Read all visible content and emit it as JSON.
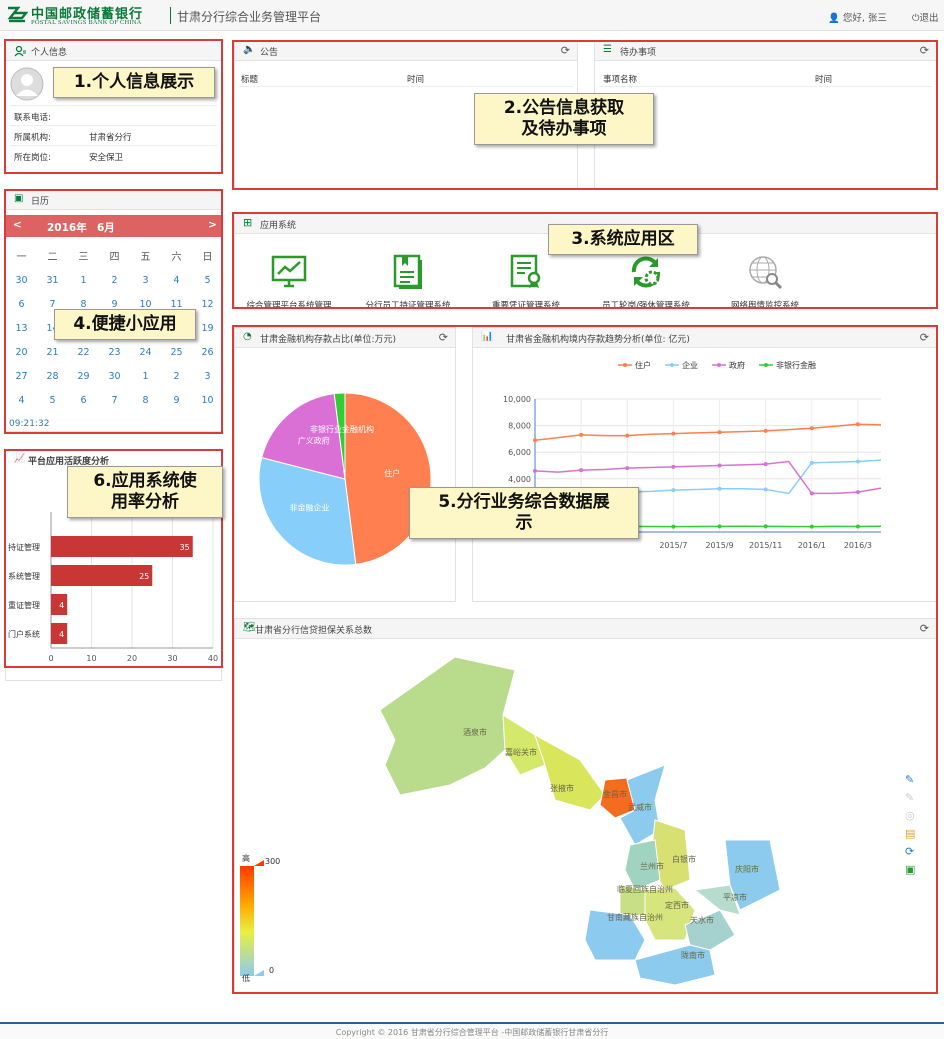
{
  "header": {
    "logo_cn": "中国邮政储蓄银行",
    "logo_en": "POSTAL SAVINGS BANK OF CHINA",
    "app_title": "甘肃分行综合业务管理平台",
    "greeting": "您好, 张三",
    "logout": "退出"
  },
  "profile": {
    "title": "个人信息",
    "rows": [
      {
        "label": "联系电话:",
        "value": ""
      },
      {
        "label": "所属机构:",
        "value": "甘肃省分行"
      },
      {
        "label": "所在岗位:",
        "value": "安全保卫"
      }
    ]
  },
  "notice": {
    "title": "公告",
    "col_title": "标题",
    "col_time": "时间"
  },
  "todo": {
    "title": "待办事项",
    "col_name": "事项名称",
    "col_time": "时间"
  },
  "calendar": {
    "title": "日历",
    "year": "2016年",
    "month": "6月",
    "prev": "<",
    "next": ">",
    "weekdays": [
      "一",
      "二",
      "三",
      "四",
      "五",
      "六",
      "日"
    ],
    "weeks": [
      [
        "30",
        "31",
        "1",
        "2",
        "3",
        "4",
        "5"
      ],
      [
        "6",
        "7",
        "8",
        "9",
        "10",
        "11",
        "12"
      ],
      [
        "13",
        "14",
        "15",
        "16",
        "17",
        "18",
        "19"
      ],
      [
        "20",
        "21",
        "22",
        "23",
        "24",
        "25",
        "26"
      ],
      [
        "27",
        "28",
        "29",
        "30",
        "1",
        "2",
        "3"
      ],
      [
        "4",
        "5",
        "6",
        "7",
        "8",
        "9",
        "10"
      ]
    ],
    "time": "09:21:32"
  },
  "apps": {
    "title": "应用系统",
    "items": [
      {
        "label": "综合管理平台系统管理",
        "icon": "monitor-chart-icon"
      },
      {
        "label": "分行员工持证管理系统",
        "icon": "certificate-book-icon"
      },
      {
        "label": "重要凭证管理系统",
        "icon": "document-award-icon"
      },
      {
        "label": "员工轮岗/强休管理系统",
        "icon": "rotation-gear-icon"
      },
      {
        "label": "网络舆情监控系统",
        "icon": "globe-search-icon"
      }
    ]
  },
  "usage": {
    "title": "平台应用活跃度分析",
    "chart_data": {
      "type": "bar",
      "orientation": "horizontal",
      "categories": [
        "持证管理",
        "系统管理",
        "重证管理",
        "门户系统"
      ],
      "values": [
        35,
        25,
        4,
        4
      ],
      "xlim": [
        0,
        40
      ],
      "xticks": [
        "0",
        "10",
        "20",
        "30",
        "40"
      ],
      "color": "#c93636"
    }
  },
  "pie": {
    "title": "甘肃金融机构存款占比(单位:万元)",
    "chart_data": {
      "type": "pie",
      "slices": [
        {
          "label": "住户",
          "value": 48,
          "color": "#ff7f50"
        },
        {
          "label": "非金融企业",
          "value": 31,
          "color": "#87cefa"
        },
        {
          "label": "广义政府",
          "value": 19,
          "color": "#da70d6"
        },
        {
          "label": "非银行业金融机构",
          "value": 2,
          "color": "#32cd32"
        }
      ]
    }
  },
  "line": {
    "title": "甘肃省金融机构境内存款趋势分析(单位: 亿元)",
    "chart_data": {
      "type": "line",
      "x": [
        "2015/1",
        "2015/2",
        "2015/3",
        "2015/4",
        "2015/5",
        "2015/6",
        "2015/7",
        "2015/8",
        "2015/9",
        "2015/10",
        "2015/11",
        "2015/12",
        "2016/1",
        "2016/2",
        "2016/3",
        "2016/4"
      ],
      "xticks": [
        "2015/7",
        "2015/9",
        "2015/11",
        "2016/1",
        "2016/3"
      ],
      "ylim": [
        0,
        10000
      ],
      "yticks": [
        "10,000",
        "8,000",
        "6,000",
        "4,000"
      ],
      "series": [
        {
          "name": "住户",
          "color": "#ff7f50",
          "values": [
            6900,
            7100,
            7300,
            7250,
            7250,
            7350,
            7400,
            7450,
            7500,
            7550,
            7600,
            7700,
            7800,
            7950,
            8100,
            8050
          ]
        },
        {
          "name": "企业",
          "color": "#87cefa",
          "values": [
            3100,
            3000,
            2950,
            3050,
            3000,
            3050,
            3150,
            3200,
            3250,
            3250,
            3200,
            2900,
            5200,
            5250,
            5300,
            5400
          ]
        },
        {
          "name": "政府",
          "color": "#da70d6",
          "values": [
            4600,
            4500,
            4650,
            4700,
            4800,
            4850,
            4900,
            4950,
            5000,
            5050,
            5100,
            5300,
            2900,
            2900,
            3000,
            3300
          ]
        },
        {
          "name": "非银行金融",
          "color": "#32cd32",
          "values": [
            400,
            420,
            410,
            400,
            420,
            410,
            400,
            410,
            420,
            430,
            420,
            410,
            400,
            420,
            410,
            430
          ]
        }
      ]
    }
  },
  "map": {
    "title": "甘肃省分行信贷担保关系总数",
    "legend_high": "高",
    "legend_low": "低",
    "legend_max": "300",
    "legend_min": "0",
    "cities": [
      "酒泉市",
      "嘉峪关市",
      "张掖市",
      "金昌市",
      "武威市",
      "兰州市",
      "白银市",
      "临夏回族自治州",
      "定西市",
      "甘南藏族自治州",
      "天水市",
      "平凉市",
      "庆阳市",
      "陇南市"
    ]
  },
  "callouts": {
    "c1": "1.个人信息展示",
    "c2a": "2.公告信息获取",
    "c2b": "及待办事项",
    "c3": "3.系统应用区",
    "c4": "4.便捷小应用",
    "c5a": "5.分行业务综合数据展",
    "c5b": "示",
    "c6a": "6.应用系统使",
    "c6b": "用率分析"
  },
  "footer": "Copyright © 2016 甘肃省分行综合管理平台 -中国邮政储蓄银行甘肃省分行"
}
